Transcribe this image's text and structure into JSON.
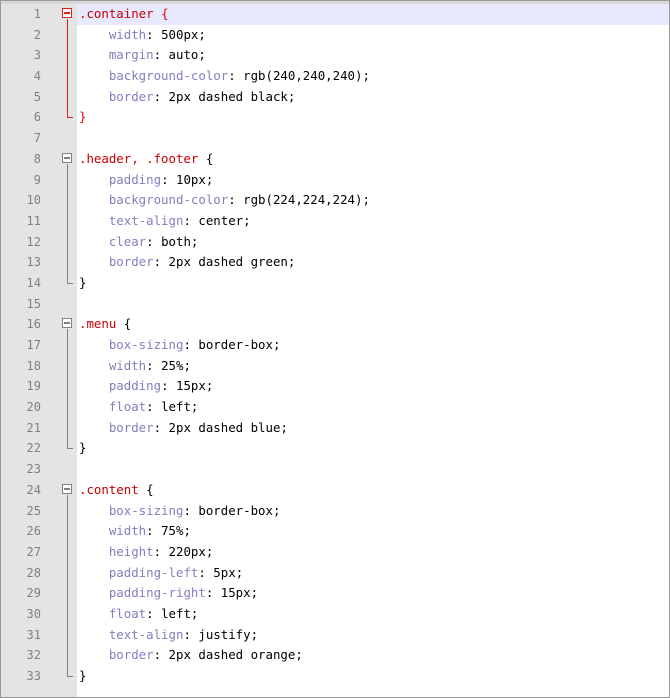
{
  "editor": {
    "current_line": 1,
    "lines": [
      {
        "num": "1",
        "tokens": [
          {
            "t": "sel",
            "v": ".container"
          },
          {
            "t": "sp",
            "v": " "
          },
          {
            "t": "brace",
            "v": "{"
          }
        ]
      },
      {
        "num": "2",
        "tokens": [
          {
            "t": "sp",
            "v": "    "
          },
          {
            "t": "prop",
            "v": "width"
          },
          {
            "t": "punct",
            "v": ": "
          },
          {
            "t": "val",
            "v": "500px"
          },
          {
            "t": "punct",
            "v": ";"
          }
        ]
      },
      {
        "num": "3",
        "tokens": [
          {
            "t": "sp",
            "v": "    "
          },
          {
            "t": "prop",
            "v": "margin"
          },
          {
            "t": "punct",
            "v": ": "
          },
          {
            "t": "val",
            "v": "auto"
          },
          {
            "t": "punct",
            "v": ";"
          }
        ]
      },
      {
        "num": "4",
        "tokens": [
          {
            "t": "sp",
            "v": "    "
          },
          {
            "t": "prop",
            "v": "background-color"
          },
          {
            "t": "punct",
            "v": ": "
          },
          {
            "t": "val",
            "v": "rgb(240,240,240)"
          },
          {
            "t": "punct",
            "v": ";"
          }
        ]
      },
      {
        "num": "5",
        "tokens": [
          {
            "t": "sp",
            "v": "    "
          },
          {
            "t": "prop",
            "v": "border"
          },
          {
            "t": "punct",
            "v": ": "
          },
          {
            "t": "val",
            "v": "2px dashed black"
          },
          {
            "t": "punct",
            "v": ";"
          }
        ]
      },
      {
        "num": "6",
        "tokens": [
          {
            "t": "brace",
            "v": "}"
          }
        ]
      },
      {
        "num": "7",
        "tokens": []
      },
      {
        "num": "8",
        "tokens": [
          {
            "t": "sel",
            "v": ".header, .footer"
          },
          {
            "t": "sp",
            "v": " "
          },
          {
            "t": "brace",
            "v": "{"
          }
        ]
      },
      {
        "num": "9",
        "tokens": [
          {
            "t": "sp",
            "v": "    "
          },
          {
            "t": "prop",
            "v": "padding"
          },
          {
            "t": "punct",
            "v": ": "
          },
          {
            "t": "val",
            "v": "10px"
          },
          {
            "t": "punct",
            "v": ";"
          }
        ]
      },
      {
        "num": "10",
        "tokens": [
          {
            "t": "sp",
            "v": "    "
          },
          {
            "t": "prop",
            "v": "background-color"
          },
          {
            "t": "punct",
            "v": ": "
          },
          {
            "t": "val",
            "v": "rgb(224,224,224)"
          },
          {
            "t": "punct",
            "v": ";"
          }
        ]
      },
      {
        "num": "11",
        "tokens": [
          {
            "t": "sp",
            "v": "    "
          },
          {
            "t": "prop",
            "v": "text-align"
          },
          {
            "t": "punct",
            "v": ": "
          },
          {
            "t": "val",
            "v": "center"
          },
          {
            "t": "punct",
            "v": ";"
          }
        ]
      },
      {
        "num": "12",
        "tokens": [
          {
            "t": "sp",
            "v": "    "
          },
          {
            "t": "prop",
            "v": "clear"
          },
          {
            "t": "punct",
            "v": ": "
          },
          {
            "t": "val",
            "v": "both"
          },
          {
            "t": "punct",
            "v": ";"
          }
        ]
      },
      {
        "num": "13",
        "tokens": [
          {
            "t": "sp",
            "v": "    "
          },
          {
            "t": "prop",
            "v": "border"
          },
          {
            "t": "punct",
            "v": ": "
          },
          {
            "t": "val",
            "v": "2px dashed green"
          },
          {
            "t": "punct",
            "v": ";"
          }
        ]
      },
      {
        "num": "14",
        "tokens": [
          {
            "t": "brace",
            "v": "}"
          }
        ]
      },
      {
        "num": "15",
        "tokens": []
      },
      {
        "num": "16",
        "tokens": [
          {
            "t": "sel",
            "v": ".menu"
          },
          {
            "t": "sp",
            "v": " "
          },
          {
            "t": "brace",
            "v": "{"
          }
        ]
      },
      {
        "num": "17",
        "tokens": [
          {
            "t": "sp",
            "v": "    "
          },
          {
            "t": "prop",
            "v": "box-sizing"
          },
          {
            "t": "punct",
            "v": ": "
          },
          {
            "t": "val",
            "v": "border-box"
          },
          {
            "t": "punct",
            "v": ";"
          }
        ]
      },
      {
        "num": "18",
        "tokens": [
          {
            "t": "sp",
            "v": "    "
          },
          {
            "t": "prop",
            "v": "width"
          },
          {
            "t": "punct",
            "v": ": "
          },
          {
            "t": "val",
            "v": "25%"
          },
          {
            "t": "punct",
            "v": ";"
          }
        ]
      },
      {
        "num": "19",
        "tokens": [
          {
            "t": "sp",
            "v": "    "
          },
          {
            "t": "prop",
            "v": "padding"
          },
          {
            "t": "punct",
            "v": ": "
          },
          {
            "t": "val",
            "v": "15px"
          },
          {
            "t": "punct",
            "v": ";"
          }
        ]
      },
      {
        "num": "20",
        "tokens": [
          {
            "t": "sp",
            "v": "    "
          },
          {
            "t": "prop",
            "v": "float"
          },
          {
            "t": "punct",
            "v": ": "
          },
          {
            "t": "val",
            "v": "left"
          },
          {
            "t": "punct",
            "v": ";"
          }
        ]
      },
      {
        "num": "21",
        "tokens": [
          {
            "t": "sp",
            "v": "    "
          },
          {
            "t": "prop",
            "v": "border"
          },
          {
            "t": "punct",
            "v": ": "
          },
          {
            "t": "val",
            "v": "2px dashed blue"
          },
          {
            "t": "punct",
            "v": ";"
          }
        ]
      },
      {
        "num": "22",
        "tokens": [
          {
            "t": "brace",
            "v": "}"
          }
        ]
      },
      {
        "num": "23",
        "tokens": []
      },
      {
        "num": "24",
        "tokens": [
          {
            "t": "sel",
            "v": ".content"
          },
          {
            "t": "sp",
            "v": " "
          },
          {
            "t": "brace",
            "v": "{"
          }
        ]
      },
      {
        "num": "25",
        "tokens": [
          {
            "t": "sp",
            "v": "    "
          },
          {
            "t": "prop",
            "v": "box-sizing"
          },
          {
            "t": "punct",
            "v": ": "
          },
          {
            "t": "val",
            "v": "border-box"
          },
          {
            "t": "punct",
            "v": ";"
          }
        ]
      },
      {
        "num": "26",
        "tokens": [
          {
            "t": "sp",
            "v": "    "
          },
          {
            "t": "prop",
            "v": "width"
          },
          {
            "t": "punct",
            "v": ": "
          },
          {
            "t": "val",
            "v": "75%"
          },
          {
            "t": "punct",
            "v": ";"
          }
        ]
      },
      {
        "num": "27",
        "tokens": [
          {
            "t": "sp",
            "v": "    "
          },
          {
            "t": "prop",
            "v": "height"
          },
          {
            "t": "punct",
            "v": ": "
          },
          {
            "t": "val",
            "v": "220px"
          },
          {
            "t": "punct",
            "v": ";"
          }
        ]
      },
      {
        "num": "28",
        "tokens": [
          {
            "t": "sp",
            "v": "    "
          },
          {
            "t": "prop",
            "v": "padding-left"
          },
          {
            "t": "punct",
            "v": ": "
          },
          {
            "t": "val",
            "v": "5px"
          },
          {
            "t": "punct",
            "v": ";"
          }
        ]
      },
      {
        "num": "29",
        "tokens": [
          {
            "t": "sp",
            "v": "    "
          },
          {
            "t": "prop",
            "v": "padding-right"
          },
          {
            "t": "punct",
            "v": ": "
          },
          {
            "t": "val",
            "v": "15px"
          },
          {
            "t": "punct",
            "v": ";"
          }
        ]
      },
      {
        "num": "30",
        "tokens": [
          {
            "t": "sp",
            "v": "    "
          },
          {
            "t": "prop",
            "v": "float"
          },
          {
            "t": "punct",
            "v": ": "
          },
          {
            "t": "val",
            "v": "left"
          },
          {
            "t": "punct",
            "v": ";"
          }
        ]
      },
      {
        "num": "31",
        "tokens": [
          {
            "t": "sp",
            "v": "    "
          },
          {
            "t": "prop",
            "v": "text-align"
          },
          {
            "t": "punct",
            "v": ": "
          },
          {
            "t": "val",
            "v": "justify"
          },
          {
            "t": "punct",
            "v": ";"
          }
        ]
      },
      {
        "num": "32",
        "tokens": [
          {
            "t": "sp",
            "v": "    "
          },
          {
            "t": "prop",
            "v": "border"
          },
          {
            "t": "punct",
            "v": ": "
          },
          {
            "t": "val",
            "v": "2px dashed orange"
          },
          {
            "t": "punct",
            "v": ";"
          }
        ]
      },
      {
        "num": "33",
        "tokens": [
          {
            "t": "brace",
            "v": "}"
          }
        ]
      }
    ],
    "folds": [
      {
        "start": 1,
        "end": 6,
        "active": true
      },
      {
        "start": 8,
        "end": 14,
        "active": false
      },
      {
        "start": 16,
        "end": 22,
        "active": false
      },
      {
        "start": 24,
        "end": 33,
        "active": false
      }
    ]
  },
  "colors": {
    "selector": "#c80000",
    "property": "#8080c0",
    "value": "#000000",
    "gutter": "#e4e4e4",
    "current_line": "#e8e8ff",
    "fold_active": "#e02020",
    "fold_inactive": "#808080"
  }
}
